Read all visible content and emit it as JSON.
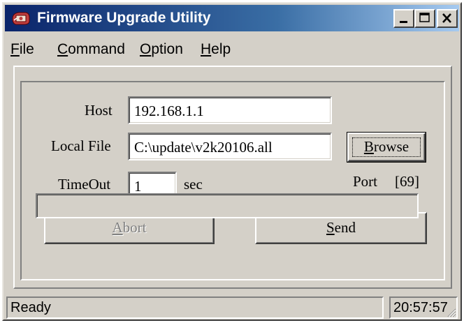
{
  "window": {
    "title": "Firmware Upgrade Utility",
    "icon": "app-chip-icon"
  },
  "title_buttons": {
    "minimize": "minimize-icon",
    "maximize": "maximize-icon",
    "close": "close-icon"
  },
  "menu": {
    "items": [
      {
        "accel": "F",
        "rest": "ile"
      },
      {
        "accel": "C",
        "rest": "ommand"
      },
      {
        "accel": "O",
        "rest": "ption"
      },
      {
        "accel": "H",
        "rest": "elp"
      }
    ]
  },
  "form": {
    "host_label": "Host",
    "host_value": "192.168.1.1",
    "local_file_label": "Local File",
    "local_file_value": "C:\\update\\v2k20106.all",
    "timeout_label": "TimeOut",
    "timeout_value": "1",
    "timeout_unit": "sec",
    "port_label": "Port",
    "port_value": "[69]"
  },
  "buttons": {
    "browse_accel": "B",
    "browse_rest": "rowse",
    "abort_accel": "A",
    "abort_rest": "bort",
    "send_accel": "S",
    "send_rest": "end"
  },
  "progress": {
    "value": 0
  },
  "status": {
    "text": "Ready",
    "time": "20:57:57"
  },
  "colors": {
    "titlebar_start": "#0a246a",
    "titlebar_end": "#a6caf0",
    "face": "#d4d0c8"
  }
}
